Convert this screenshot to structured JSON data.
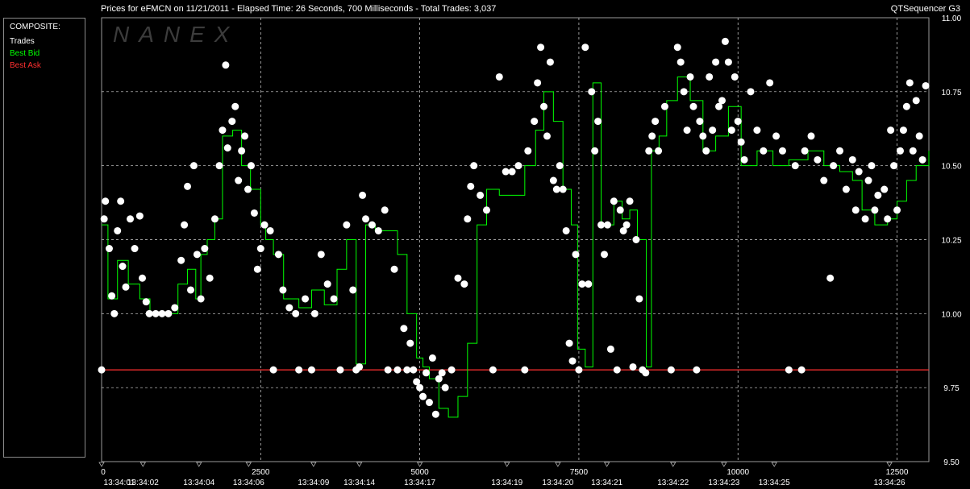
{
  "header": {
    "title": "Prices for  eFMCN  on  11/21/2011  -  Elapsed Time: 26 Seconds, 700 Milliseconds  -  Total Trades: 3,037",
    "app": "QTSequencer G3"
  },
  "watermark": "NANEX",
  "legend": {
    "header": "COMPOSITE:",
    "items": [
      {
        "label": "Trades",
        "color": "#ffffff"
      },
      {
        "label": "Best Bid",
        "color": "#00ff00"
      },
      {
        "label": "Best Ask",
        "color": "#ff3030"
      }
    ]
  },
  "chart_data": {
    "type": "scatter",
    "xlim": [
      0,
      13000
    ],
    "ylim": [
      9.5,
      11.0
    ],
    "x_ticks": [
      0,
      2500,
      5000,
      7500,
      10000,
      12500
    ],
    "y_ticks": [
      9.5,
      9.75,
      10.0,
      10.25,
      10.5,
      10.75,
      11.0
    ],
    "y_tick_labels": [
      "9.50",
      "9.75",
      "10.00",
      "10.25",
      "10.50",
      "10.75",
      "11.00"
    ],
    "time_labels": [
      {
        "x": 0,
        "label": "13:34:01"
      },
      {
        "x": 650,
        "label": "13:34:02"
      },
      {
        "x": 1530,
        "label": "13:34:04"
      },
      {
        "x": 2310,
        "label": "13:34:06"
      },
      {
        "x": 3330,
        "label": "13:34:09"
      },
      {
        "x": 4050,
        "label": "13:34:14"
      },
      {
        "x": 5000,
        "label": "13:34:17"
      },
      {
        "x": 6370,
        "label": "13:34:19"
      },
      {
        "x": 7170,
        "label": "13:34:20"
      },
      {
        "x": 7940,
        "label": "13:34:21"
      },
      {
        "x": 8980,
        "label": "13:34:22"
      },
      {
        "x": 9780,
        "label": "13:34:23"
      },
      {
        "x": 10570,
        "label": "13:34:25"
      },
      {
        "x": 12380,
        "label": "13:34:26"
      }
    ],
    "grid": true,
    "series": [
      {
        "name": "Best Ask",
        "color": "#ff3030",
        "type": "line",
        "points": [
          [
            0,
            9.81
          ],
          [
            13000,
            9.81
          ]
        ]
      },
      {
        "name": "Best Bid",
        "color": "#00ff00",
        "type": "step",
        "points": [
          [
            0,
            10.3
          ],
          [
            100,
            10.05
          ],
          [
            250,
            10.18
          ],
          [
            420,
            10.1
          ],
          [
            600,
            10.05
          ],
          [
            760,
            10.0
          ],
          [
            1000,
            10.0
          ],
          [
            1200,
            10.1
          ],
          [
            1350,
            10.15
          ],
          [
            1480,
            10.05
          ],
          [
            1560,
            10.2
          ],
          [
            1660,
            10.25
          ],
          [
            1780,
            10.32
          ],
          [
            1900,
            10.6
          ],
          [
            2060,
            10.62
          ],
          [
            2200,
            10.5
          ],
          [
            2340,
            10.42
          ],
          [
            2500,
            10.3
          ],
          [
            2580,
            10.25
          ],
          [
            2700,
            10.2
          ],
          [
            2860,
            10.05
          ],
          [
            3100,
            10.02
          ],
          [
            3300,
            10.08
          ],
          [
            3500,
            10.03
          ],
          [
            3700,
            10.15
          ],
          [
            3850,
            10.25
          ],
          [
            4000,
            9.83
          ],
          [
            4150,
            10.3
          ],
          [
            4300,
            10.28
          ],
          [
            4500,
            10.28
          ],
          [
            4650,
            10.2
          ],
          [
            4800,
            10.0
          ],
          [
            4950,
            9.85
          ],
          [
            5050,
            9.82
          ],
          [
            5150,
            9.78
          ],
          [
            5300,
            9.68
          ],
          [
            5450,
            9.65
          ],
          [
            5600,
            9.72
          ],
          [
            5750,
            9.9
          ],
          [
            5900,
            10.3
          ],
          [
            6050,
            10.42
          ],
          [
            6250,
            10.4
          ],
          [
            6450,
            10.4
          ],
          [
            6650,
            10.5
          ],
          [
            6820,
            10.62
          ],
          [
            6950,
            10.75
          ],
          [
            7100,
            10.65
          ],
          [
            7250,
            10.42
          ],
          [
            7380,
            10.3
          ],
          [
            7480,
            9.88
          ],
          [
            7600,
            9.82
          ],
          [
            7720,
            10.78
          ],
          [
            7850,
            10.3
          ],
          [
            8050,
            10.38
          ],
          [
            8180,
            10.32
          ],
          [
            8300,
            10.35
          ],
          [
            8420,
            10.25
          ],
          [
            8560,
            9.82
          ],
          [
            8640,
            10.55
          ],
          [
            8760,
            10.6
          ],
          [
            8880,
            10.72
          ],
          [
            9050,
            10.8
          ],
          [
            9250,
            10.72
          ],
          [
            9450,
            10.55
          ],
          [
            9650,
            10.6
          ],
          [
            9850,
            10.7
          ],
          [
            10050,
            10.5
          ],
          [
            10300,
            10.55
          ],
          [
            10550,
            10.5
          ],
          [
            10800,
            10.52
          ],
          [
            11100,
            10.55
          ],
          [
            11350,
            10.5
          ],
          [
            11600,
            10.48
          ],
          [
            11800,
            10.45
          ],
          [
            11950,
            10.35
          ],
          [
            12150,
            10.3
          ],
          [
            12350,
            10.32
          ],
          [
            12500,
            10.38
          ],
          [
            12650,
            10.45
          ],
          [
            12800,
            10.5
          ],
          [
            13000,
            10.55
          ]
        ]
      },
      {
        "name": "Trades",
        "color": "#ffffff",
        "type": "scatter",
        "points": [
          [
            0,
            9.81
          ],
          [
            40,
            10.32
          ],
          [
            60,
            10.38
          ],
          [
            120,
            10.22
          ],
          [
            160,
            10.06
          ],
          [
            200,
            10.0
          ],
          [
            250,
            10.28
          ],
          [
            300,
            10.38
          ],
          [
            330,
            10.16
          ],
          [
            380,
            10.09
          ],
          [
            450,
            10.32
          ],
          [
            520,
            10.22
          ],
          [
            600,
            10.33
          ],
          [
            640,
            10.12
          ],
          [
            700,
            10.04
          ],
          [
            750,
            10.0
          ],
          [
            850,
            10.0
          ],
          [
            950,
            10.0
          ],
          [
            1050,
            10.0
          ],
          [
            1150,
            10.02
          ],
          [
            1250,
            10.18
          ],
          [
            1300,
            10.3
          ],
          [
            1350,
            10.43
          ],
          [
            1400,
            10.08
          ],
          [
            1450,
            10.5
          ],
          [
            1500,
            10.2
          ],
          [
            1560,
            10.05
          ],
          [
            1620,
            10.22
          ],
          [
            1700,
            10.12
          ],
          [
            1780,
            10.32
          ],
          [
            1850,
            10.5
          ],
          [
            1900,
            10.62
          ],
          [
            1950,
            10.84
          ],
          [
            1980,
            10.56
          ],
          [
            2050,
            10.65
          ],
          [
            2100,
            10.7
          ],
          [
            2150,
            10.45
          ],
          [
            2200,
            10.55
          ],
          [
            2250,
            10.6
          ],
          [
            2300,
            10.42
          ],
          [
            2350,
            10.5
          ],
          [
            2400,
            10.34
          ],
          [
            2450,
            10.15
          ],
          [
            2500,
            10.22
          ],
          [
            2560,
            10.3
          ],
          [
            2650,
            10.28
          ],
          [
            2700,
            9.81
          ],
          [
            2780,
            10.2
          ],
          [
            2850,
            10.08
          ],
          [
            2950,
            10.02
          ],
          [
            3050,
            10.0
          ],
          [
            3100,
            9.81
          ],
          [
            3200,
            10.05
          ],
          [
            3300,
            9.81
          ],
          [
            3350,
            10.0
          ],
          [
            3450,
            10.2
          ],
          [
            3550,
            10.1
          ],
          [
            3650,
            10.05
          ],
          [
            3750,
            9.81
          ],
          [
            3850,
            10.3
          ],
          [
            3950,
            10.08
          ],
          [
            4000,
            9.81
          ],
          [
            4050,
            9.82
          ],
          [
            4100,
            10.4
          ],
          [
            4150,
            10.32
          ],
          [
            4250,
            10.3
          ],
          [
            4350,
            10.28
          ],
          [
            4450,
            10.35
          ],
          [
            4500,
            9.81
          ],
          [
            4600,
            10.15
          ],
          [
            4650,
            9.81
          ],
          [
            4750,
            9.95
          ],
          [
            4800,
            9.81
          ],
          [
            4850,
            9.9
          ],
          [
            4900,
            9.81
          ],
          [
            4950,
            9.77
          ],
          [
            5000,
            9.75
          ],
          [
            5050,
            9.72
          ],
          [
            5100,
            9.8
          ],
          [
            5150,
            9.7
          ],
          [
            5200,
            9.85
          ],
          [
            5250,
            9.66
          ],
          [
            5300,
            9.78
          ],
          [
            5350,
            9.8
          ],
          [
            5400,
            9.75
          ],
          [
            5500,
            9.81
          ],
          [
            5600,
            10.12
          ],
          [
            5700,
            10.1
          ],
          [
            5750,
            10.32
          ],
          [
            5800,
            10.43
          ],
          [
            5850,
            10.5
          ],
          [
            5950,
            10.4
          ],
          [
            6050,
            10.35
          ],
          [
            6150,
            9.81
          ],
          [
            6250,
            10.8
          ],
          [
            6350,
            10.48
          ],
          [
            6450,
            10.48
          ],
          [
            6550,
            10.5
          ],
          [
            6650,
            9.81
          ],
          [
            6700,
            10.55
          ],
          [
            6800,
            10.65
          ],
          [
            6850,
            10.78
          ],
          [
            6900,
            10.9
          ],
          [
            6950,
            10.7
          ],
          [
            7000,
            10.6
          ],
          [
            7050,
            10.85
          ],
          [
            7100,
            10.45
          ],
          [
            7150,
            10.42
          ],
          [
            7200,
            10.5
          ],
          [
            7250,
            10.42
          ],
          [
            7300,
            10.28
          ],
          [
            7350,
            9.9
          ],
          [
            7400,
            9.84
          ],
          [
            7450,
            10.2
          ],
          [
            7500,
            9.81
          ],
          [
            7550,
            10.1
          ],
          [
            7600,
            10.9
          ],
          [
            7650,
            10.1
          ],
          [
            7700,
            10.75
          ],
          [
            7750,
            10.55
          ],
          [
            7800,
            10.65
          ],
          [
            7850,
            10.3
          ],
          [
            7900,
            10.2
          ],
          [
            7950,
            10.3
          ],
          [
            8000,
            9.88
          ],
          [
            8050,
            10.38
          ],
          [
            8100,
            9.81
          ],
          [
            8150,
            10.35
          ],
          [
            8200,
            10.28
          ],
          [
            8250,
            10.3
          ],
          [
            8300,
            10.38
          ],
          [
            8350,
            9.82
          ],
          [
            8400,
            10.25
          ],
          [
            8450,
            10.05
          ],
          [
            8500,
            9.81
          ],
          [
            8550,
            9.8
          ],
          [
            8600,
            10.55
          ],
          [
            8650,
            10.6
          ],
          [
            8700,
            10.65
          ],
          [
            8750,
            10.55
          ],
          [
            8850,
            10.7
          ],
          [
            8950,
            9.81
          ],
          [
            9050,
            10.9
          ],
          [
            9100,
            10.85
          ],
          [
            9150,
            10.75
          ],
          [
            9200,
            10.62
          ],
          [
            9250,
            10.8
          ],
          [
            9300,
            10.7
          ],
          [
            9350,
            9.81
          ],
          [
            9400,
            10.65
          ],
          [
            9450,
            10.6
          ],
          [
            9500,
            10.55
          ],
          [
            9550,
            10.8
          ],
          [
            9600,
            10.62
          ],
          [
            9650,
            10.85
          ],
          [
            9700,
            10.7
          ],
          [
            9750,
            10.72
          ],
          [
            9800,
            10.92
          ],
          [
            9850,
            10.85
          ],
          [
            9900,
            10.62
          ],
          [
            9950,
            10.8
          ],
          [
            10000,
            10.65
          ],
          [
            10050,
            10.58
          ],
          [
            10100,
            10.52
          ],
          [
            10200,
            10.75
          ],
          [
            10300,
            10.62
          ],
          [
            10400,
            10.55
          ],
          [
            10500,
            10.78
          ],
          [
            10600,
            10.6
          ],
          [
            10700,
            10.55
          ],
          [
            10800,
            9.81
          ],
          [
            10900,
            10.5
          ],
          [
            11000,
            9.81
          ],
          [
            11050,
            10.55
          ],
          [
            11150,
            10.6
          ],
          [
            11250,
            10.52
          ],
          [
            11350,
            10.45
          ],
          [
            11450,
            10.12
          ],
          [
            11500,
            10.5
          ],
          [
            11600,
            10.55
          ],
          [
            11700,
            10.42
          ],
          [
            11800,
            10.52
          ],
          [
            11850,
            10.35
          ],
          [
            11900,
            10.48
          ],
          [
            12000,
            10.32
          ],
          [
            12050,
            10.45
          ],
          [
            12100,
            10.5
          ],
          [
            12150,
            10.35
          ],
          [
            12200,
            10.4
          ],
          [
            12300,
            10.42
          ],
          [
            12350,
            10.32
          ],
          [
            12400,
            10.62
          ],
          [
            12450,
            10.5
          ],
          [
            12500,
            10.35
          ],
          [
            12550,
            10.55
          ],
          [
            12600,
            10.62
          ],
          [
            12650,
            10.7
          ],
          [
            12700,
            10.78
          ],
          [
            12750,
            10.55
          ],
          [
            12800,
            10.72
          ],
          [
            12850,
            10.6
          ],
          [
            12900,
            10.52
          ],
          [
            12950,
            10.77
          ]
        ]
      }
    ]
  }
}
